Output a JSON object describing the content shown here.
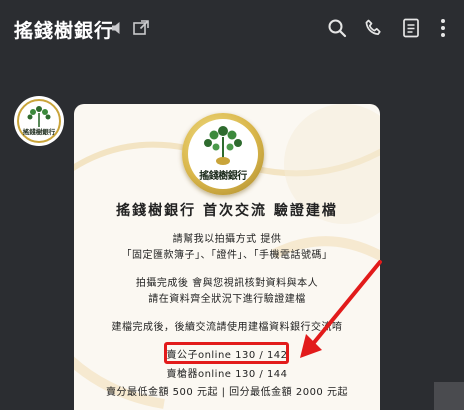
{
  "header": {
    "title": "搖錢樹銀行",
    "icons": [
      "speaker-icon",
      "external-link-icon",
      "search-icon",
      "phone-icon",
      "notes-icon",
      "more-options-icon"
    ]
  },
  "avatar": {
    "logo_text": "搖錢樹銀行"
  },
  "message_card": {
    "logo_text": "搖錢樹銀行",
    "title": "搖錢樹銀行  首次交流 驗證建檔",
    "paragraphs": [
      "請幫我以拍攝方式 提供",
      "「固定匯款簿子」、「證件」、「手機電話號碼」",
      "拍攝完成後 會與您視訊核對資料與本人",
      "請在資料齊全狀況下進行驗證建檔",
      "建檔完成後，後續交流請使用建檔資料銀行交流唷"
    ],
    "highlight_line": "賣公子online  130 / 142",
    "line_after": "賣槍器online  130 / 144",
    "bottom_line": "賣分最低金額  500 元起 | 回分最低金額 2000 元起"
  },
  "colors": {
    "background": "#2b2d31",
    "card": "#fbf8f2",
    "highlight": "#e21b1b",
    "gold": "#d9b64a"
  }
}
